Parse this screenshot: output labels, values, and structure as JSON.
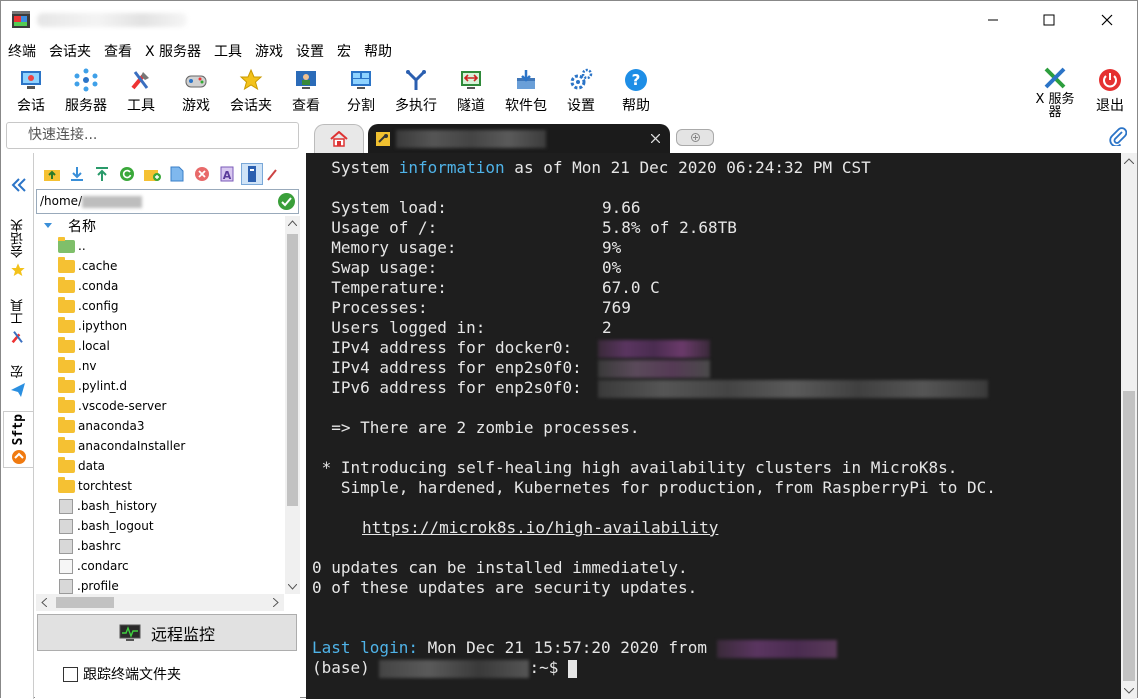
{
  "menubar": [
    "终端",
    "会话夹",
    "查看",
    "X 服务器",
    "工具",
    "游戏",
    "设置",
    "宏",
    "帮助"
  ],
  "toolbar": {
    "left": [
      {
        "label": "会话",
        "icon": "session-icon"
      },
      {
        "label": "服务器",
        "icon": "servers-icon"
      },
      {
        "label": "工具",
        "icon": "tools-icon"
      },
      {
        "label": "游戏",
        "icon": "games-icon"
      },
      {
        "label": "会话夹",
        "icon": "star-icon"
      },
      {
        "label": "查看",
        "icon": "view-icon"
      },
      {
        "label": "分割",
        "icon": "split-icon"
      },
      {
        "label": "多执行",
        "icon": "multiexec-icon"
      },
      {
        "label": "隧道",
        "icon": "tunnel-icon"
      },
      {
        "label": "软件包",
        "icon": "packages-icon"
      },
      {
        "label": "设置",
        "icon": "gear-icon"
      },
      {
        "label": "帮助",
        "icon": "help-icon"
      }
    ],
    "xserver_line1": "X 服务",
    "xserver_line2": "器",
    "exit_label": "退出"
  },
  "quick_connect": {
    "placeholder": "快速连接..."
  },
  "side_tabs": [
    "会话夹",
    "工具",
    "宏",
    "Sftp"
  ],
  "sftp": {
    "path": "/home/",
    "column_name": "名称",
    "files": [
      {
        "name": "..",
        "type": "up"
      },
      {
        "name": ".cache",
        "type": "folder"
      },
      {
        "name": ".conda",
        "type": "folder"
      },
      {
        "name": ".config",
        "type": "folder"
      },
      {
        "name": ".ipython",
        "type": "folder"
      },
      {
        "name": ".local",
        "type": "folder"
      },
      {
        "name": ".nv",
        "type": "folder"
      },
      {
        "name": ".pylint.d",
        "type": "folder"
      },
      {
        "name": ".vscode-server",
        "type": "folder"
      },
      {
        "name": "anaconda3",
        "type": "folder"
      },
      {
        "name": "anacondaInstaller",
        "type": "folder"
      },
      {
        "name": "data",
        "type": "folder"
      },
      {
        "name": "torchtest",
        "type": "folder"
      },
      {
        "name": ".bash_history",
        "type": "file"
      },
      {
        "name": ".bash_logout",
        "type": "file"
      },
      {
        "name": ".bashrc",
        "type": "file"
      },
      {
        "name": ".condarc",
        "type": "file"
      },
      {
        "name": ".profile",
        "type": "file"
      }
    ],
    "monitor_label": "远程监控",
    "follow_label": "跟踪终端文件夹"
  },
  "terminal": {
    "header_pre": "  System ",
    "header_word": "information",
    "header_post": " as of Mon 21 Dec 2020 06:24:32 PM CST",
    "stats": [
      {
        "label": "  System load:  ",
        "value": "9.66"
      },
      {
        "label": "  Usage of /:   ",
        "value": "5.8% of 2.68TB"
      },
      {
        "label": "  Memory usage: ",
        "value": "9%"
      },
      {
        "label": "  Swap usage:   ",
        "value": "0%"
      },
      {
        "label": "  Temperature:  ",
        "value": "67.0 C"
      },
      {
        "label": "  Processes:    ",
        "value": "769"
      },
      {
        "label": "  Users logged in:",
        "value": "2"
      }
    ],
    "ip_lines": [
      "  IPv4 address for docker0:",
      "  IPv4 address for enp2s0f0:",
      "  IPv6 address for enp2s0f0:"
    ],
    "zombie": "  => There are 2 zombie processes.",
    "intro1": " * Introducing self-healing high availability clusters in MicroK8s.",
    "intro2": "   Simple, hardened, Kubernetes for production, from RaspberryPi to DC.",
    "link": "https://microk8s.io/high-availability",
    "updates1": "0 updates can be installed immediately.",
    "updates2": "0 of these updates are security updates.",
    "last_login_label": "Last login:",
    "last_login_value": " Mon Dec 21 15:57:20 2020 from ",
    "prompt_prefix": "(base) ",
    "prompt_suffix": ":~$ "
  }
}
